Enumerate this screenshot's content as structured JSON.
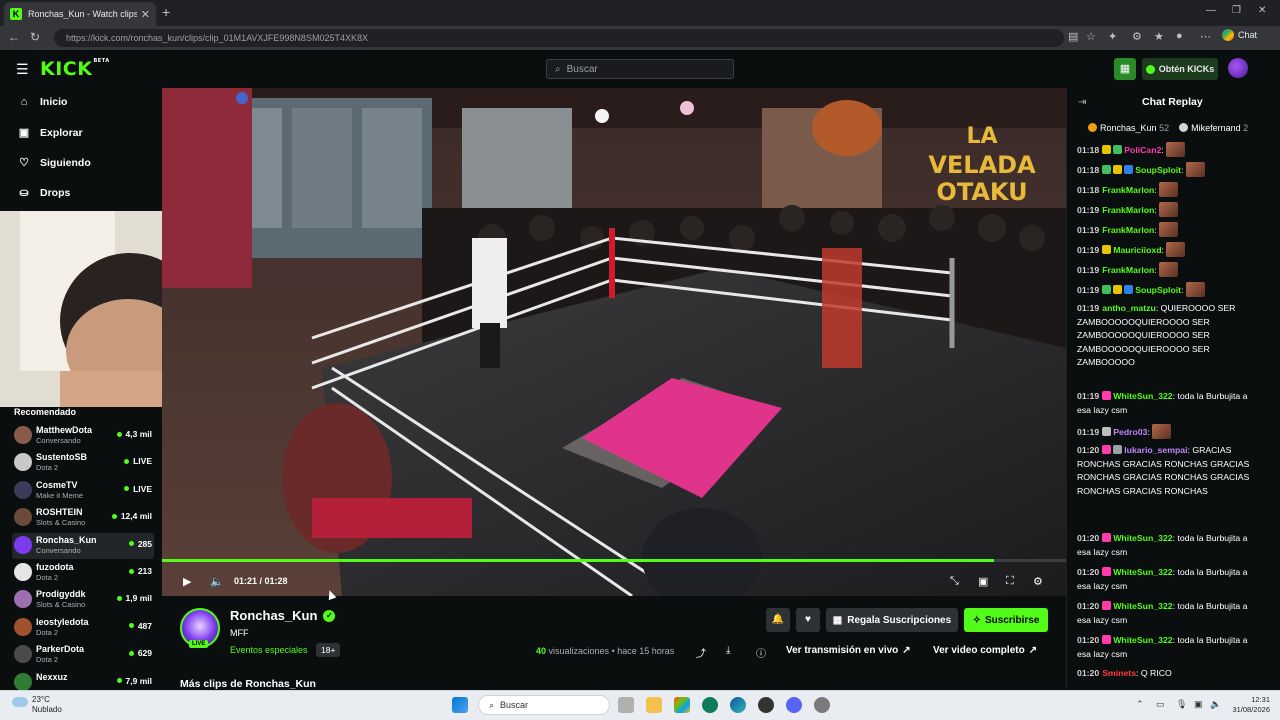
{
  "browser": {
    "tab_title": "Ronchas_Kun - Watch clips on Kick",
    "url": "https://kick.com/ronchas_kun/clips/clip_01M1AVXJFE998N8SM025T4XK8X",
    "chat_button": "Chat"
  },
  "header": {
    "logo": "KICK",
    "logo_badge": "BETA",
    "search_placeholder": "Buscar",
    "kicks_button": "Obtén KICKs"
  },
  "sidebar": {
    "nav": [
      {
        "label": "Inicio",
        "icon": "home-icon"
      },
      {
        "label": "Explorar",
        "icon": "compass-icon"
      },
      {
        "label": "Siguiendo",
        "icon": "heart-icon"
      },
      {
        "label": "Drops",
        "icon": "gift-icon"
      }
    ],
    "recommended_title": "Recomendado",
    "recommended": [
      {
        "name": "MatthewDota",
        "category": "Conversando",
        "viewers": "4,3 mil",
        "avatar_color": "#8a5a4a"
      },
      {
        "name": "SustentoSB",
        "category": "Dota 2",
        "viewers": "LIVE",
        "avatar_color": "#c9c9c9"
      },
      {
        "name": "CosmeTV",
        "category": "Make it Meme",
        "viewers": "LIVE",
        "avatar_color": "#3b3b5a"
      },
      {
        "name": "ROSHTEIN",
        "category": "Slots & Casino",
        "viewers": "12,4 mil",
        "avatar_color": "#6b4a3a"
      },
      {
        "name": "Ronchas_Kun",
        "category": "Conversando",
        "viewers": "285",
        "avatar_color": "#7c3aed"
      },
      {
        "name": "fuzodota",
        "category": "Dota 2",
        "viewers": "213",
        "avatar_color": "#e5e5e5"
      },
      {
        "name": "Prodigyddk",
        "category": "Slots & Casino",
        "viewers": "1,9 mil",
        "avatar_color": "#9b6fb0"
      },
      {
        "name": "leostyledota",
        "category": "Dota 2",
        "viewers": "487",
        "avatar_color": "#a0522d"
      },
      {
        "name": "ParkerDota",
        "category": "Dota 2",
        "viewers": "629",
        "avatar_color": "#4a4a4a"
      },
      {
        "name": "Nexxuz",
        "category": "",
        "viewers": "7,9 mil",
        "avatar_color": "#2e7d32"
      }
    ]
  },
  "player": {
    "time": "01:21 / 01:28",
    "progress": 0.92
  },
  "channel": {
    "name": "Ronchas_Kun",
    "live_badge": "LIVE",
    "clip_title": "MFF",
    "category": "Eventos especiales",
    "age_badge": "18+",
    "gift_button": "Regala Suscripciones",
    "subscribe_button": "Suscribirse",
    "views_count": "40",
    "views_label": "visualizaciones",
    "posted": "hace 15 horas",
    "watch_live": "Ver transmisión en vivo",
    "watch_full": "Ver video completo",
    "more_clips": "Más clips de Ronchas_Kun"
  },
  "chat": {
    "title": "Chat Replay",
    "top_gifters": [
      {
        "name": "Ronchas_Kun",
        "count": "52",
        "color": "#f59e0b"
      },
      {
        "name": "Mikefernand",
        "count": "2",
        "color": "#d1d5db"
      }
    ],
    "messages": [
      {
        "time": "01:18",
        "user": "PoliCan2",
        "color": "#ff3cac",
        "text": ":",
        "emote": true,
        "badges": [
          "#e6c200",
          "#3fbf5f"
        ]
      },
      {
        "time": "01:18",
        "user": "SoupSploit",
        "color": "#53fc18",
        "text": ":",
        "emote": true,
        "badges": [
          "#3fbf5f",
          "#e6c200",
          "#2f80ed"
        ]
      },
      {
        "time": "01:18",
        "user": "FrankMarlon",
        "color": "#53fc18",
        "text": ":",
        "emote": true,
        "badges": []
      },
      {
        "time": "01:19",
        "user": "FrankMarlon",
        "color": "#53fc18",
        "text": ":",
        "emote": true,
        "badges": []
      },
      {
        "time": "01:19",
        "user": "FrankMarlon",
        "color": "#53fc18",
        "text": ":",
        "emote": true,
        "badges": []
      },
      {
        "time": "01:19",
        "user": "Mauriciioxd",
        "color": "#53fc18",
        "text": ":",
        "emote": true,
        "badges": [
          "#e6c200"
        ]
      },
      {
        "time": "01:19",
        "user": "FrankMarlon",
        "color": "#53fc18",
        "text": ":",
        "emote": true,
        "badges": []
      },
      {
        "time": "01:19",
        "user": "SoupSploit",
        "color": "#53fc18",
        "text": ":",
        "emote": true,
        "badges": [
          "#3fbf5f",
          "#e6c200",
          "#2f80ed"
        ]
      },
      {
        "time": "01:19",
        "user": "antho_matzu",
        "color": "#53fc18",
        "text": ": QUIEROOOO SER ZAMBOOOOOQUIEROOOO SER ZAMBOOOOOQUIEROOOO SER ZAMBOOOOOQUIEROOOO SER ZAMBOOOOO",
        "emote": false,
        "badges": []
      },
      {
        "time": "01:19",
        "user": "WhiteSun_322",
        "color": "#53fc18",
        "text": ": toda la Burbujita a esa lazy csm",
        "emote": false,
        "badges": [
          "#ff3cac"
        ]
      },
      {
        "time": "01:19",
        "user": "Pedro03",
        "color": "#c084fc",
        "text": ":",
        "emote": true,
        "badges": [
          "#bdbdbd"
        ]
      },
      {
        "time": "01:20",
        "user": "lukario_sempai",
        "color": "#c084fc",
        "text": ": GRACIAS RONCHAS  GRACIAS RONCHAS  GRACIAS RONCHAS  GRACIAS RONCHAS  GRACIAS RONCHAS  GRACIAS RONCHAS",
        "emote": false,
        "badges": [
          "#ff3cac",
          "#9aa0a6"
        ]
      },
      {
        "time": "01:20",
        "user": "WhiteSun_322",
        "color": "#53fc18",
        "text": ": toda la Burbujita a esa lazy csm",
        "emote": false,
        "badges": [
          "#ff3cac"
        ]
      },
      {
        "time": "01:20",
        "user": "WhiteSun_322",
        "color": "#53fc18",
        "text": ": toda la Burbujita a esa lazy csm",
        "emote": false,
        "badges": [
          "#ff3cac"
        ]
      },
      {
        "time": "01:20",
        "user": "WhiteSun_322",
        "color": "#53fc18",
        "text": ": toda la Burbujita a esa lazy csm",
        "emote": false,
        "badges": [
          "#ff3cac"
        ]
      },
      {
        "time": "01:20",
        "user": "WhiteSun_322",
        "color": "#53fc18",
        "text": ": toda la Burbujita a esa lazy csm",
        "emote": false,
        "badges": [
          "#ff3cac"
        ]
      },
      {
        "time": "01:20",
        "user": "Sminets",
        "color": "#ff3c3c",
        "text": ": Q RICO",
        "emote": false,
        "badges": []
      }
    ]
  },
  "taskbar": {
    "weather_temp": "23°C",
    "weather_desc": "Nublado",
    "search_label": "Buscar",
    "time": "12:31",
    "date": "31/08/2026"
  }
}
